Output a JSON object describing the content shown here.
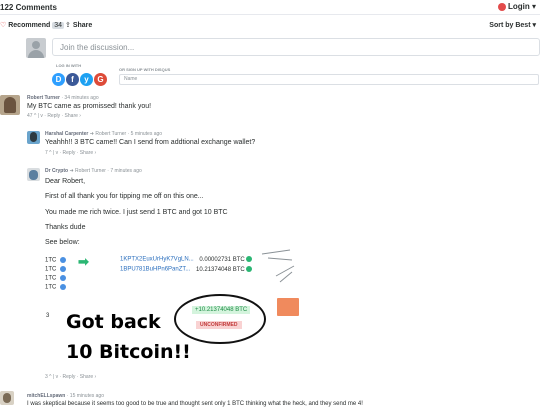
{
  "header": {
    "comments_count": "122 Comments",
    "login": "Login",
    "recommend": "Recommend",
    "recommend_count": "34",
    "share": "Share",
    "sort": "Sort by Best"
  },
  "composer": {
    "placeholder": "Join the discussion...",
    "login_with": "LOG IN WITH",
    "signup": "OR SIGN UP WITH DISQUS",
    "name_placeholder": "Name",
    "social": [
      "D",
      "f",
      "y",
      "G"
    ]
  },
  "comments": [
    {
      "author": "Robert Turner",
      "time": "34 minutes ago",
      "text": "My BTC came as promissed! thank you!",
      "votes": "47 ^ | v · Reply · Share ›"
    },
    {
      "author": "Harshal Carpenter",
      "reply_to": "Robert Turner",
      "time": "5 minutes ago",
      "text": "Yeahhh!! 3 BTC came!! Can I send from addtional exchange wallet?",
      "votes": "7 ^ | v · Reply · Share ›"
    },
    {
      "author": "Dr Crypto",
      "reply_to": "Robert Turner",
      "time": "7 minutes ago",
      "lines": [
        "Dear Robert,",
        "First of all thank you for tipping me off on this one...",
        "You made me rich twice. I just send 1 BTC and got 10 BTC",
        "Thanks dude",
        "See below:"
      ],
      "embed": {
        "left_labels": [
          "1TC",
          "1TC",
          "1TC",
          "1TC"
        ],
        "tx1_hash": "1KPTX2EuxUrHyK7VgLN...",
        "tx1_amount": "0.00002731 BTC",
        "tx2_hash": "1BPU781BuHPn6PanZT...",
        "tx2_amount": "10.21374048 BTC",
        "credit": "+10.21374048 BTC",
        "status": "UNCONFIRMED",
        "stray_digit": "3",
        "overlay_line1": "Got back",
        "overlay_line2": "10 Bitcoin!!"
      },
      "votes": "3 ^ | v · Reply · Share ›"
    },
    {
      "author": "mitchELLspawn",
      "time": "15 minutes ago",
      "text": "I was skeptical because it seems too good to be true and thought sent only 1 BTC thinking what the heck, and they send me 4!"
    }
  ]
}
